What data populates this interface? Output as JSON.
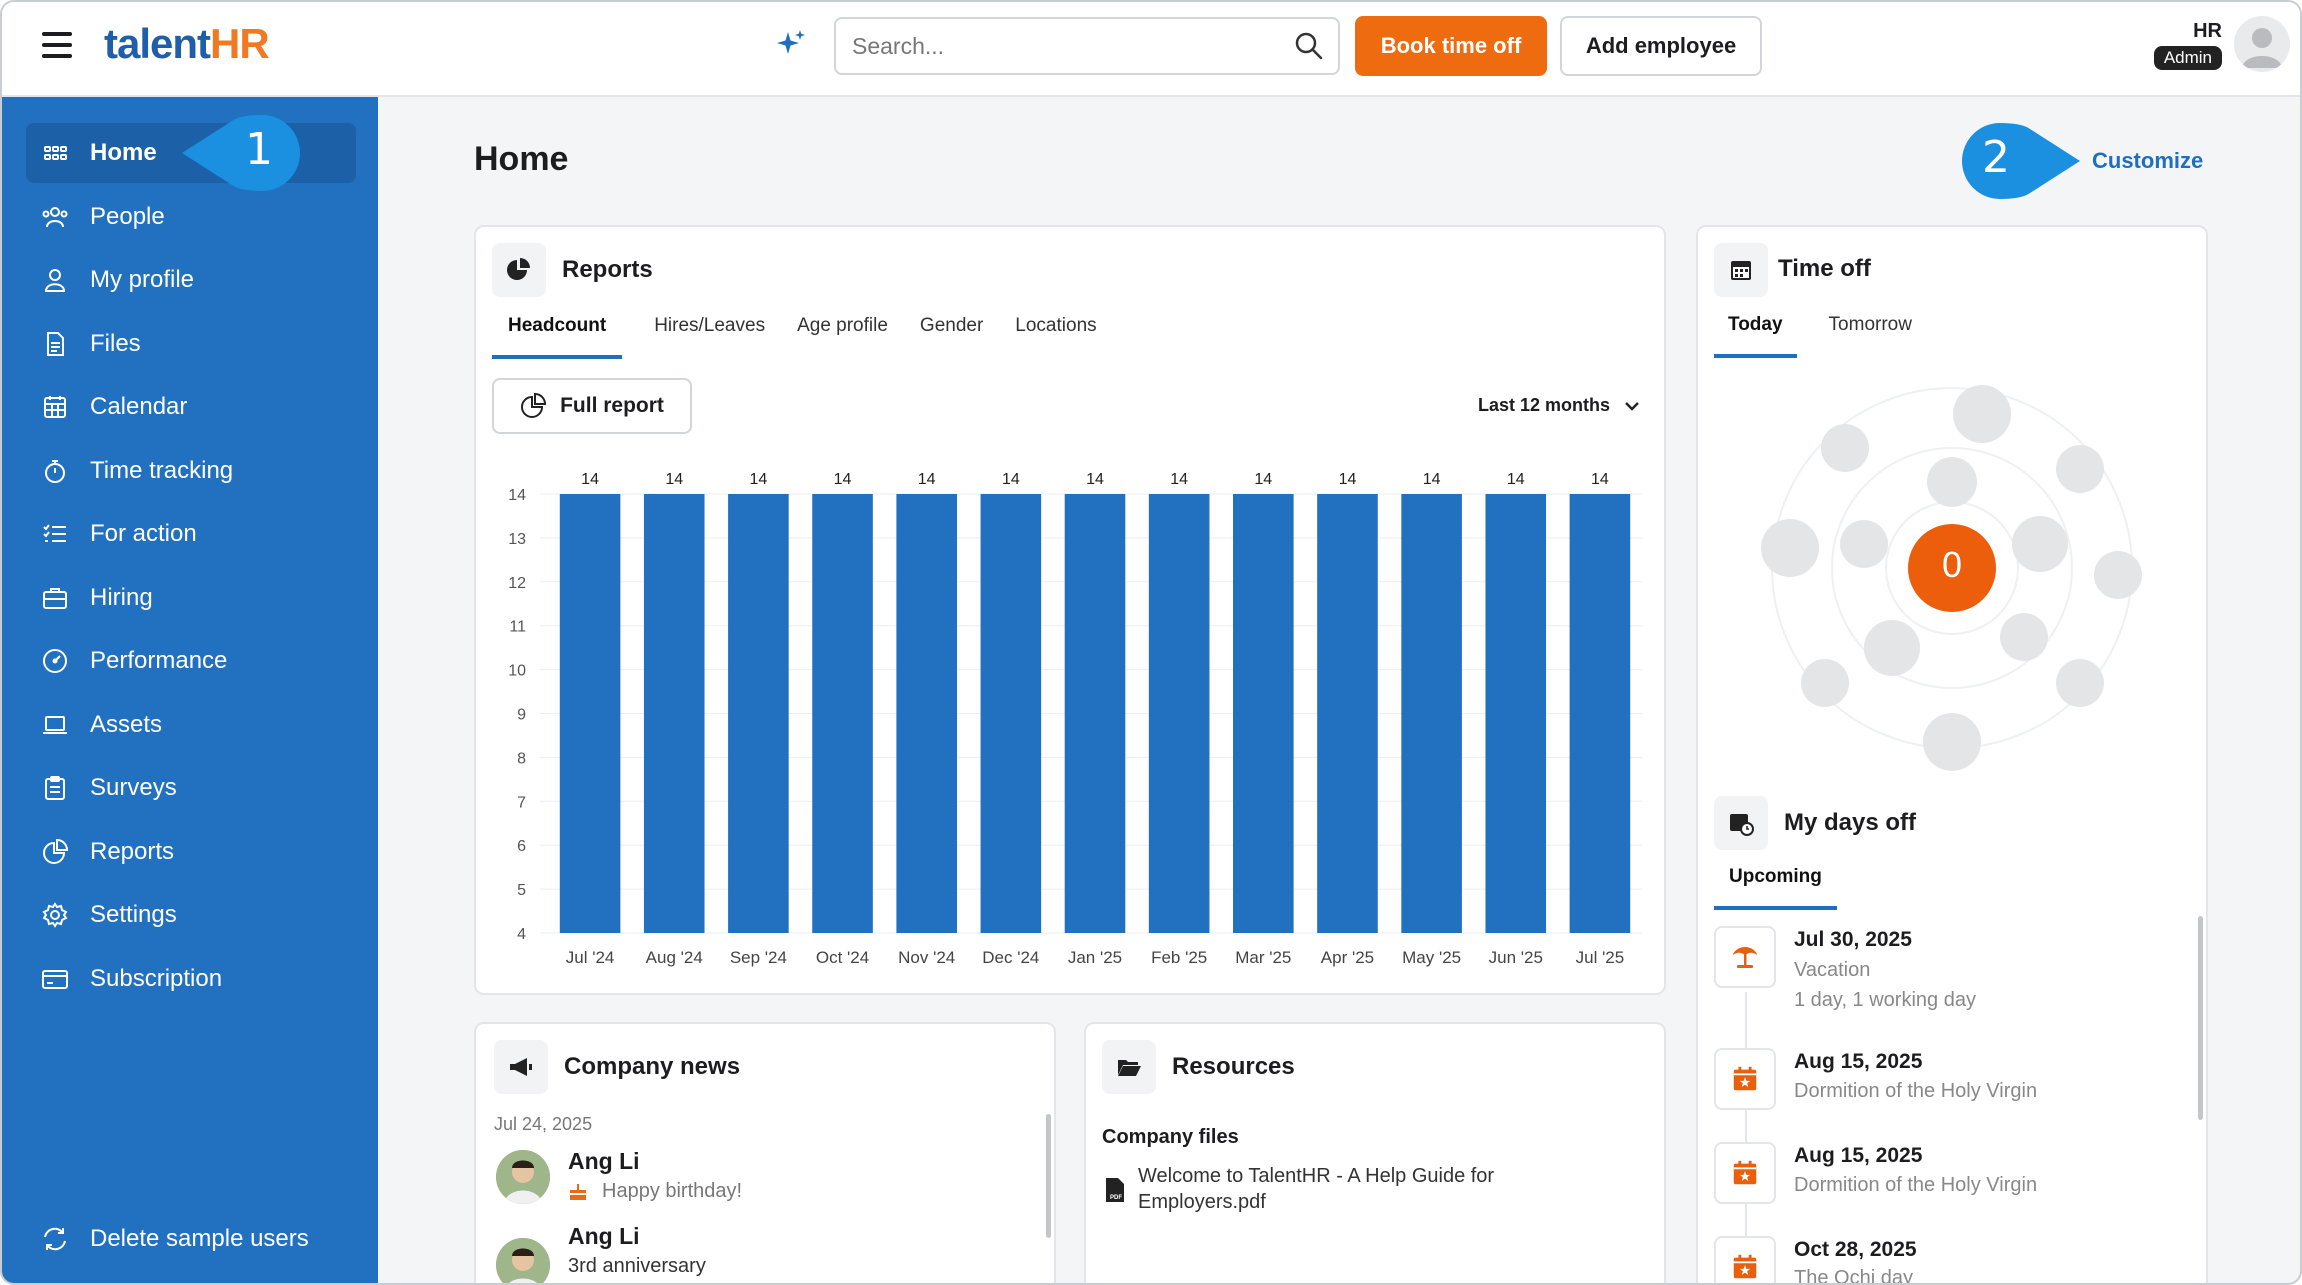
{
  "app": {
    "logo_talent": "talent",
    "logo_hr": "HR"
  },
  "header": {
    "search_placeholder": "Search...",
    "book_time_off": "Book time off",
    "add_employee": "Add employee",
    "user_initials": "HR",
    "user_role": "Admin"
  },
  "sidebar": {
    "items": [
      {
        "label": "Home",
        "icon": "grid-icon"
      },
      {
        "label": "People",
        "icon": "people-icon"
      },
      {
        "label": "My profile",
        "icon": "user-icon"
      },
      {
        "label": "Files",
        "icon": "file-icon"
      },
      {
        "label": "Calendar",
        "icon": "calendar-icon"
      },
      {
        "label": "Time tracking",
        "icon": "stopwatch-icon"
      },
      {
        "label": "For action",
        "icon": "checklist-icon"
      },
      {
        "label": "Hiring",
        "icon": "briefcase-icon"
      },
      {
        "label": "Performance",
        "icon": "gauge-icon"
      },
      {
        "label": "Assets",
        "icon": "laptop-icon"
      },
      {
        "label": "Surveys",
        "icon": "clipboard-icon"
      },
      {
        "label": "Reports",
        "icon": "piechart-icon"
      },
      {
        "label": "Settings",
        "icon": "gear-icon"
      },
      {
        "label": "Subscription",
        "icon": "card-icon"
      }
    ],
    "footer": "Delete sample users"
  },
  "callouts": {
    "one": "1",
    "two": "2"
  },
  "main": {
    "title": "Home",
    "customize": "Customize"
  },
  "reports": {
    "title": "Reports",
    "tabs": [
      "Headcount",
      "Hires/Leaves",
      "Age profile",
      "Gender",
      "Locations"
    ],
    "full_report": "Full report",
    "period": "Last 12 months"
  },
  "chart_data": {
    "type": "bar",
    "categories": [
      "Jul '24",
      "Aug '24",
      "Sep '24",
      "Oct '24",
      "Nov '24",
      "Dec '24",
      "Jan '25",
      "Feb '25",
      "Mar '25",
      "Apr '25",
      "May '25",
      "Jun '25",
      "Jul '25"
    ],
    "values": [
      14,
      14,
      14,
      14,
      14,
      14,
      14,
      14,
      14,
      14,
      14,
      14,
      14
    ],
    "yticks": [
      4,
      5,
      6,
      7,
      8,
      9,
      10,
      11,
      12,
      13,
      14
    ],
    "ylim": [
      4,
      14
    ],
    "color": "#2270c0"
  },
  "time_off": {
    "title": "Time off",
    "tabs": [
      "Today",
      "Tomorrow"
    ],
    "count": "0"
  },
  "my_days_off": {
    "title": "My days off",
    "tab": "Upcoming",
    "items": [
      {
        "date": "Jul 30, 2025",
        "name": "Vacation",
        "detail": "1 day, 1 working day",
        "icon": "beach-icon"
      },
      {
        "date": "Aug 15, 2025",
        "name": "Dormition of the Holy Virgin",
        "icon": "holiday-calendar-icon"
      },
      {
        "date": "Aug 15, 2025",
        "name": "Dormition of the Holy Virgin",
        "icon": "holiday-calendar-icon"
      },
      {
        "date": "Oct 28, 2025",
        "name": "The Ochi day",
        "icon": "holiday-calendar-icon"
      }
    ]
  },
  "company_news": {
    "title": "Company news",
    "date": "Jul 24, 2025",
    "items": [
      {
        "name": "Ang Li",
        "text": "Happy birthday!"
      },
      {
        "name": "Ang Li",
        "text": "3rd anniversary"
      }
    ]
  },
  "resources": {
    "title": "Resources",
    "subtitle": "Company files",
    "file": "Welcome to TalentHR - A Help Guide for Employers.pdf"
  }
}
